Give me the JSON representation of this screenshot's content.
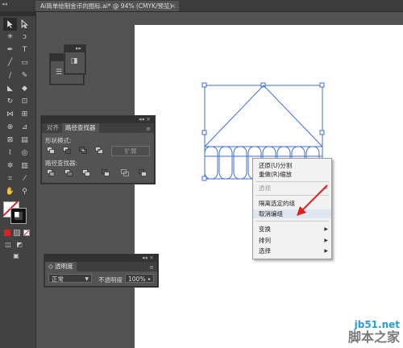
{
  "tab": {
    "title": "Ai简单绘制金币的图标.ai* @ 94% (CMYK/预览)",
    "close": "×"
  },
  "pathfinder_panel": {
    "tabs": [
      "对齐",
      "路径查找器"
    ],
    "shape_modes_label": "形状模式:",
    "expand_label": "扩展",
    "pathfinders_label": "路径查找器:"
  },
  "transparency_panel": {
    "title": "透明度",
    "blend_mode": "正常",
    "opacity_label": "不透明度",
    "opacity_value": "100%"
  },
  "context_menu": {
    "items": [
      {
        "label": "还原(U)分割",
        "disabled": false,
        "submenu": false
      },
      {
        "label": "重做(R)缩放",
        "disabled": false,
        "submenu": false
      },
      {
        "label": "透视",
        "disabled": true,
        "submenu": true
      },
      {
        "label": "隔离选定的组",
        "disabled": false,
        "submenu": false
      },
      {
        "label": "取消编组",
        "disabled": false,
        "submenu": false,
        "highlight": true
      },
      {
        "label": "变换",
        "disabled": false,
        "submenu": true
      },
      {
        "label": "排列",
        "disabled": false,
        "submenu": true
      },
      {
        "label": "选择",
        "disabled": false,
        "submenu": true
      }
    ]
  },
  "watermark": {
    "url": "jb51.net",
    "name": "脚本之家"
  },
  "colors": {
    "selection": "#3d6fd1",
    "annotation_arrow": "#e02020",
    "canvas": "#ffffff",
    "app_bg": "#535353"
  }
}
